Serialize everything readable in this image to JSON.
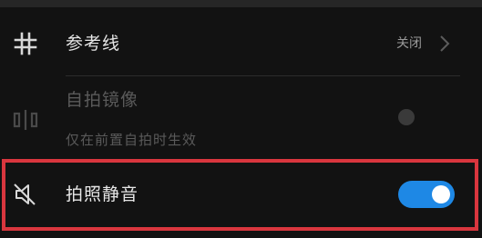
{
  "settings": {
    "items": [
      {
        "label": "参考线",
        "value": "关闭",
        "icon": "grid-icon",
        "chevron": "chevron-right-icon"
      },
      {
        "label": "自拍镜像",
        "description": "仅在前置自拍时生效",
        "icon": "mirror-icon",
        "toggle_state": "off"
      },
      {
        "label": "拍照静音",
        "icon": "mute-icon",
        "toggle_state": "on"
      }
    ]
  },
  "colors": {
    "background": "#121212",
    "text_primary": "#e6e6e6",
    "text_disabled": "#5a5a5a",
    "toggle_on": "#1e88e5",
    "highlight_border": "#d9363e"
  }
}
